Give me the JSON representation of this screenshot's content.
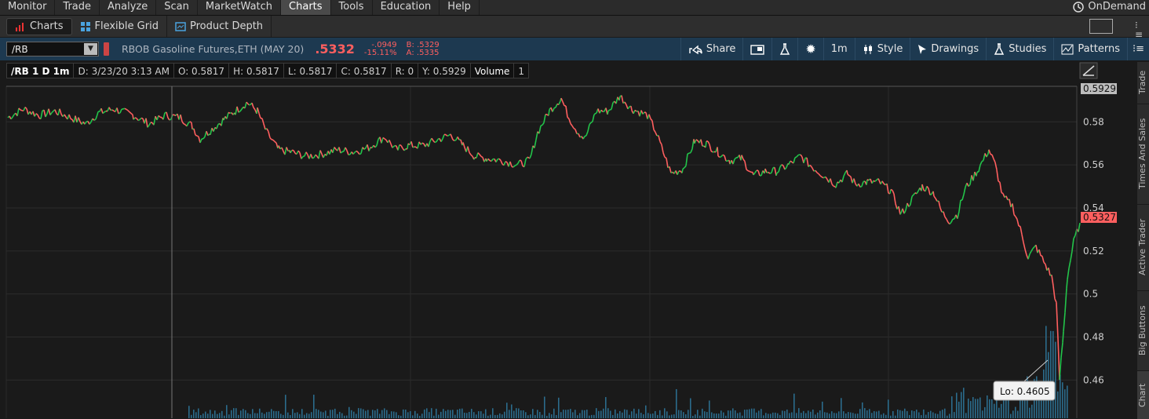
{
  "menu": [
    "Monitor",
    "Trade",
    "Analyze",
    "Scan",
    "MarketWatch",
    "Charts",
    "Tools",
    "Education",
    "Help"
  ],
  "menu_active": "Charts",
  "ondemand": "OnDemand",
  "tabs": {
    "charts": "Charts",
    "flexible_grid": "Flexible Grid",
    "product_depth": "Product Depth"
  },
  "toolbar": {
    "symbol": "/RB",
    "instrument_name": "RBOB Gasoline Futures,ETH (MAY 20)",
    "last": ".5332",
    "net_change": "-.0949",
    "pct_change": "-15.11%",
    "bid": "B: .5329",
    "ask": "A: .5335",
    "share": "Share",
    "aggregation": "1m",
    "style": "Style",
    "drawings": "Drawings",
    "studies": "Studies",
    "patterns": "Patterns"
  },
  "infobar": {
    "title": "/RB 1 D 1m",
    "date": "D: 3/23/20 3:13 AM",
    "open": "O: 0.5817",
    "high": "H: 0.5817",
    "low": "L: 0.5817",
    "close": "C: 0.5817",
    "range": "R: 0",
    "y": "Y: 0.5929",
    "volume_label": "Volume",
    "volume_value": "1"
  },
  "sidebar_tabs": [
    "Trade",
    "Times And Sales",
    "Active Trader",
    "Big Buttons",
    "Chart"
  ],
  "colors": {
    "up": "#23c44a",
    "down": "#ff5f5f",
    "volume": "#2b6c8c",
    "bg": "#1a1a1a",
    "toolbar": "#1d3950"
  },
  "chart_data": {
    "type": "line",
    "title": "/RB 1 D 1m",
    "price_axis_ticks": [
      "0.58",
      "0.56",
      "0.54",
      "0.52",
      "0.5",
      "0.48",
      "0.46"
    ],
    "ylim": [
      0.443,
      0.5965
    ],
    "y_marker_top": "0.5929",
    "y_marker_last": "0.5327",
    "low_label": "Lo: 0.4605",
    "price_path": [
      [
        0,
        0.582
      ],
      [
        20,
        0.586
      ],
      [
        40,
        0.583
      ],
      [
        60,
        0.585
      ],
      [
        80,
        0.582
      ],
      [
        100,
        0.579
      ],
      [
        115,
        0.584
      ],
      [
        135,
        0.586
      ],
      [
        160,
        0.583
      ],
      [
        180,
        0.579
      ],
      [
        200,
        0.583
      ],
      [
        220,
        0.582
      ],
      [
        235,
        0.578
      ],
      [
        245,
        0.572
      ],
      [
        258,
        0.576
      ],
      [
        275,
        0.581
      ],
      [
        290,
        0.585
      ],
      [
        305,
        0.589
      ],
      [
        318,
        0.585
      ],
      [
        330,
        0.575
      ],
      [
        345,
        0.567
      ],
      [
        360,
        0.566
      ],
      [
        380,
        0.564
      ],
      [
        400,
        0.565
      ],
      [
        420,
        0.567
      ],
      [
        440,
        0.566
      ],
      [
        460,
        0.568
      ],
      [
        480,
        0.573
      ],
      [
        495,
        0.567
      ],
      [
        510,
        0.569
      ],
      [
        530,
        0.569
      ],
      [
        550,
        0.572
      ],
      [
        565,
        0.574
      ],
      [
        580,
        0.569
      ],
      [
        595,
        0.564
      ],
      [
        610,
        0.563
      ],
      [
        630,
        0.562
      ],
      [
        650,
        0.56
      ],
      [
        665,
        0.562
      ],
      [
        675,
        0.575
      ],
      [
        690,
        0.585
      ],
      [
        705,
        0.591
      ],
      [
        715,
        0.582
      ],
      [
        725,
        0.576
      ],
      [
        735,
        0.572
      ],
      [
        750,
        0.585
      ],
      [
        765,
        0.585
      ],
      [
        780,
        0.592
      ],
      [
        795,
        0.586
      ],
      [
        815,
        0.583
      ],
      [
        825,
        0.576
      ],
      [
        835,
        0.566
      ],
      [
        845,
        0.556
      ],
      [
        860,
        0.558
      ],
      [
        875,
        0.571
      ],
      [
        890,
        0.57
      ],
      [
        905,
        0.566
      ],
      [
        920,
        0.562
      ],
      [
        935,
        0.563
      ],
      [
        950,
        0.555
      ],
      [
        965,
        0.557
      ],
      [
        980,
        0.557
      ],
      [
        995,
        0.56
      ],
      [
        1010,
        0.564
      ],
      [
        1025,
        0.559
      ],
      [
        1040,
        0.555
      ],
      [
        1055,
        0.551
      ],
      [
        1070,
        0.556
      ],
      [
        1080,
        0.551
      ],
      [
        1095,
        0.552
      ],
      [
        1110,
        0.552
      ],
      [
        1125,
        0.548
      ],
      [
        1138,
        0.537
      ],
      [
        1150,
        0.543
      ],
      [
        1165,
        0.55
      ],
      [
        1180,
        0.547
      ],
      [
        1190,
        0.538
      ],
      [
        1200,
        0.534
      ],
      [
        1210,
        0.537
      ],
      [
        1220,
        0.549
      ],
      [
        1235,
        0.557
      ],
      [
        1250,
        0.567
      ],
      [
        1258,
        0.56
      ],
      [
        1268,
        0.545
      ],
      [
        1280,
        0.541
      ],
      [
        1290,
        0.53
      ],
      [
        1300,
        0.517
      ],
      [
        1310,
        0.522
      ],
      [
        1320,
        0.515
      ],
      [
        1330,
        0.508
      ],
      [
        1336,
        0.495
      ],
      [
        1340,
        0.4605
      ],
      [
        1345,
        0.482
      ],
      [
        1350,
        0.508
      ],
      [
        1358,
        0.524
      ],
      [
        1366,
        0.533
      ]
    ],
    "series": [
      {
        "name": "Volume"
      }
    ]
  }
}
